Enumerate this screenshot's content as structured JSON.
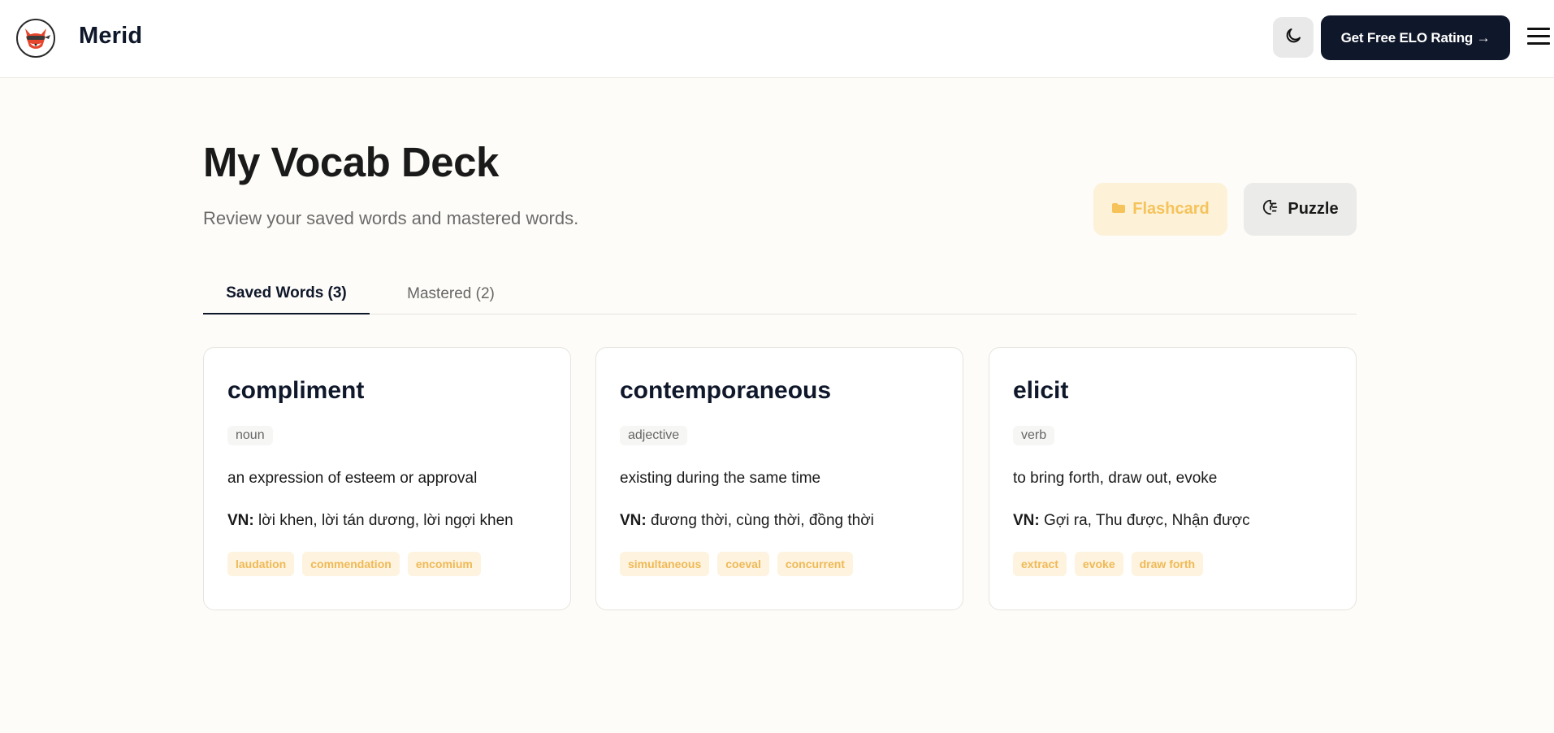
{
  "header": {
    "brand": "Merid",
    "cta_label": "Get Free ELO Rating →"
  },
  "page": {
    "title": "My Vocab Deck",
    "subtitle": "Review your saved words and mastered words.",
    "flashcard_label": "Flashcard",
    "puzzle_label": "Puzzle"
  },
  "tabs": [
    {
      "label": "Saved Words (3)"
    },
    {
      "label": "Mastered (2)"
    }
  ],
  "cards": [
    {
      "word": "compliment",
      "pos": "noun",
      "definition": "an expression of esteem or approval",
      "vn_label": "VN:",
      "vn": "lời khen, lời tán dương, lời ngợi khen",
      "synonyms": [
        "laudation",
        "commendation",
        "encomium"
      ]
    },
    {
      "word": "contemporaneous",
      "pos": "adjective",
      "definition": "existing during the same time",
      "vn_label": "VN:",
      "vn": "đương thời, cùng thời, đồng thời",
      "synonyms": [
        "simultaneous",
        "coeval",
        "concurrent"
      ]
    },
    {
      "word": "elicit",
      "pos": "verb",
      "definition": "to bring forth, draw out, evoke",
      "vn_label": "VN:",
      "vn": "Gợi ra, Thu được, Nhận được",
      "synonyms": [
        "extract",
        "evoke",
        "draw forth"
      ]
    }
  ],
  "icons": {
    "logo": "fox-ninja-logo-icon",
    "theme": "moon-icon",
    "menu": "hamburger-menu-icon",
    "flashcard": "flashcard-icon",
    "puzzle": "puzzle-icon"
  },
  "colors": {
    "primary_dark": "#0f172a",
    "accent": "#f5c35a",
    "accent_bg": "#fdf1d8",
    "background": "#fdfcf8"
  }
}
